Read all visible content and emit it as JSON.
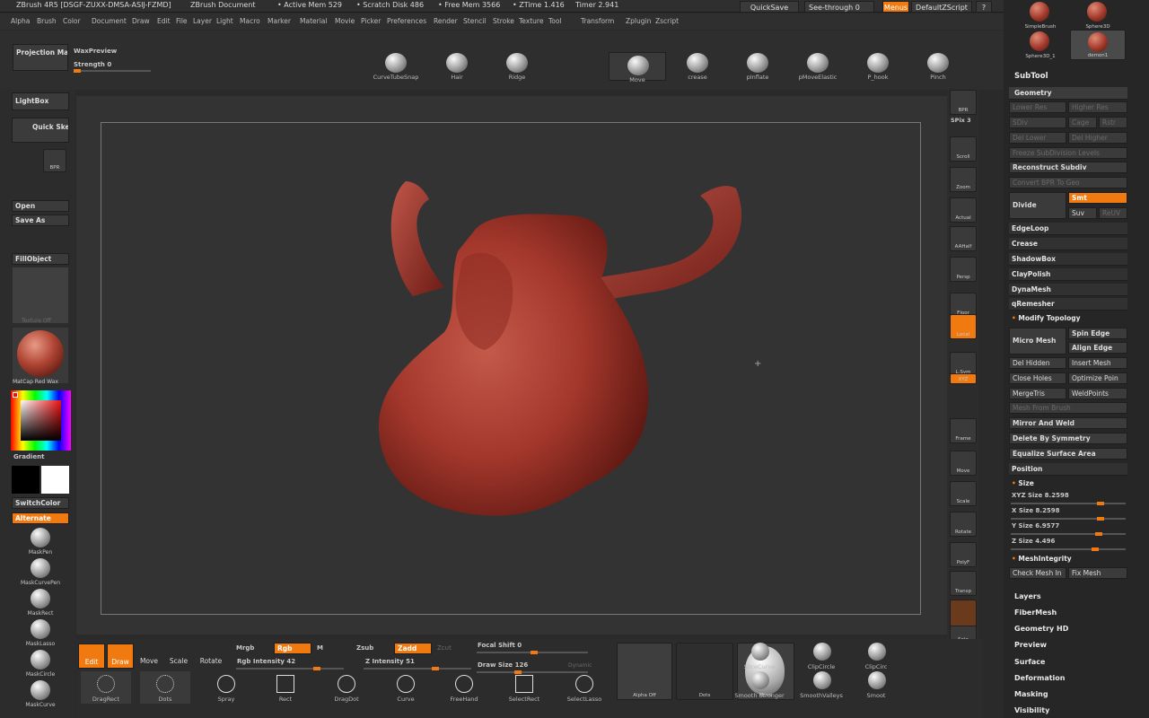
{
  "titlebar": {
    "app": "ZBrush 4R5 [DSGF-ZUXX-DMSA-ASIJ-FZMD]",
    "document": "ZBrush Document",
    "active_mem": "• Active Mem 529",
    "scratch": "• Scratch Disk 486",
    "free_mem": "• Free Mem 3566",
    "ztime": "• ZTime 1.416",
    "timer": "Timer 2.941",
    "quicksave": "QuickSave",
    "seethrough": "See-through  0",
    "menus": "Menus",
    "script": "DefaultZScript"
  },
  "menubar": [
    "Alpha",
    "Brush",
    "Color",
    "Document",
    "Draw",
    "Edit",
    "File",
    "Layer",
    "Light",
    "Macro",
    "Marker",
    "Material",
    "Movie",
    "Picker",
    "Preferences",
    "Render",
    "Stencil",
    "Stroke",
    "Texture",
    "Tool",
    "Transform",
    "Zplugin",
    "Zscript"
  ],
  "top_left": {
    "projection": "Projection Master",
    "wax": "WaxPreview",
    "strength": "Strength 0"
  },
  "top_brushes": [
    "CurveTubeSnap",
    "Hair",
    "Ridge",
    "Move",
    "crease",
    "pInflate",
    "pMoveElastic",
    "P_hook",
    "Pinch"
  ],
  "left": {
    "lightbox": "LightBox",
    "quicksketch": "Quick Sketch",
    "bpr": "BPR",
    "open": "Open",
    "saveas": "Save As",
    "fillobject": "FillObject",
    "texture": "Texture Off",
    "matcap": "MatCap Red Wax",
    "gradient": "Gradient",
    "switchcolor": "SwitchColor",
    "alternate": "Alternate",
    "masks": [
      "MaskPen",
      "MaskCurvePen",
      "MaskRect",
      "MaskLasso",
      "MaskCircle",
      "MaskCurve"
    ]
  },
  "right_tools": [
    "BPR",
    "SPix 3",
    "Scroll",
    "Zoom",
    "Actual",
    "AAHalf",
    "Persp",
    "Floor",
    "Local",
    "L.Sym",
    "XYZ",
    "Frame",
    "Move",
    "Scale",
    "Rotate",
    "PolyF",
    "Transp",
    "Solo",
    "Xpose"
  ],
  "subtool_thumbs": [
    "SimpleBrush",
    "Sphere3D",
    "Sphere3D_1",
    "demon1"
  ],
  "right": {
    "subtool": "SubTool",
    "geometry": "Geometry",
    "lower_res": "Lower Res",
    "higher_res": "Higher Res",
    "sdiv": "SDiv",
    "cage": "Cage",
    "rstr": "Rstr",
    "del_lower": "Del Lower",
    "del_higher": "Del Higher",
    "freeze": "Freeze SubDivision Levels",
    "reconstruct": "Reconstruct Subdiv",
    "convert": "Convert BPR To Geo",
    "divide": "Divide",
    "smt": "Smt",
    "suv": "Suv",
    "reuv": "ReUV",
    "edgeloop": "EdgeLoop",
    "crease": "Crease",
    "shadowbox": "ShadowBox",
    "claypolish": "ClayPolish",
    "dynamesh": "DynaMesh",
    "qremesher": "qRemesher",
    "modify": "Modify Topology",
    "micromesh": "Micro Mesh",
    "spinedge": "Spin Edge",
    "alignedge": "Align Edge",
    "delhidden": "Del Hidden",
    "insertmesh": "Insert Mesh",
    "closeholes": "Close Holes",
    "optimize": "Optimize Poin",
    "mergetris": "MergeTris",
    "weldpoints": "WeldPoints",
    "meshfrombrush": "Mesh From Brush",
    "mirrorweld": "Mirror And Weld",
    "deletesym": "Delete By Symmetry",
    "equalize": "Equalize Surface Area",
    "position": "Position",
    "size": "Size",
    "xyzsize": "XYZ Size 8.2598",
    "xsize": "X Size 8.2598",
    "ysize": "Y Size 6.9577",
    "zsize": "Z Size 4.496",
    "meshintegrity": "MeshIntegrity",
    "checkmesh": "Check Mesh In",
    "fixmesh": "Fix Mesh",
    "layers": "Layers",
    "fibermesh": "FiberMesh",
    "geometryhd": "Geometry HD",
    "preview": "Preview",
    "surface": "Surface",
    "deformation": "Deformation",
    "masking": "Masking",
    "visibility": "Visibility"
  },
  "bottom": {
    "edit": "Edit",
    "draw": "Draw",
    "move": "Move",
    "scale": "Scale",
    "rotate": "Rotate",
    "mrgb": "Mrgb",
    "rgb": "Rgb",
    "m": "M",
    "zsub": "Zsub",
    "zadd": "Zadd",
    "zcut": "Zcut",
    "rgb_intensity": "Rgb Intensity 42",
    "z_intensity": "Z Intensity 51",
    "focal": "Focal Shift 0",
    "drawsize": "Draw Size 126",
    "dynamic": "Dynamic",
    "alpha": "Alpha Off",
    "dots": "Dots",
    "material": "Move",
    "slicecurve": "SliceCurve",
    "clipcircle": "ClipCircle",
    "clipcirc": "ClipCirc",
    "smooth_stronger": "Smooth Stronger",
    "smooth_valleys": "SmoothValleys",
    "smoot": "Smoot",
    "strokes": [
      "DragRect",
      "Dots",
      "Spray",
      "Rect",
      "DragDot",
      "Curve",
      "FreeHand",
      "SelectRect",
      "SelectLasso"
    ]
  },
  "colors": {
    "accent": "#f07a10",
    "model": "#a8392e",
    "canvas": "#333333"
  }
}
